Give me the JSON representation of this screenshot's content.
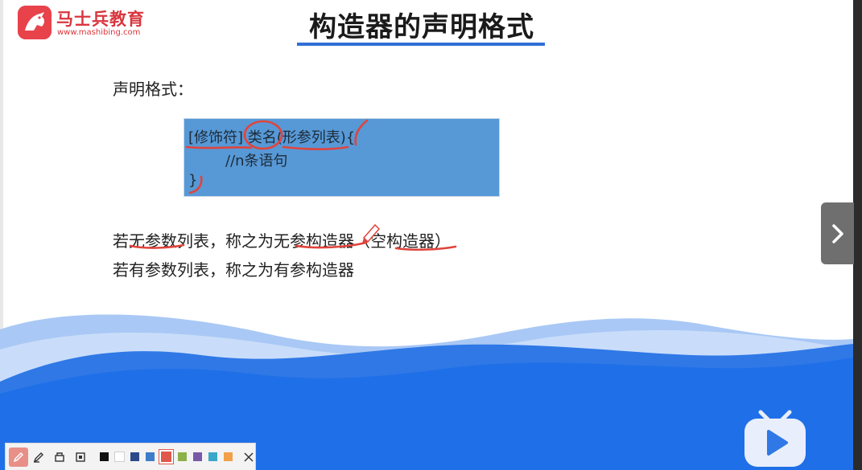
{
  "logo": {
    "name": "马士兵教育",
    "url": "www.mashibing.com"
  },
  "slide": {
    "title": "构造器的声明格式",
    "label": "声明格式：",
    "code": {
      "line1": "[修饰符] 类名(形参列表){",
      "line2": "//n条语句",
      "line3": "}"
    },
    "text1": "若无参数列表，称之为无参构造器（空构造器）",
    "text2": "若有参数列表，称之为有参构造器"
  },
  "toolbar": {
    "tools": [
      "pen-icon",
      "highlighter-icon",
      "eraser-icon",
      "clear-board-icon"
    ],
    "colors": [
      "#111111",
      "#ffffff",
      "#2c4a8a",
      "#3e7dc9",
      "#e0574c",
      "#8cb04a",
      "#7a58a8",
      "#3aa7c8",
      "#f3a04a"
    ],
    "selected_color": "#e0574c"
  },
  "nav": {
    "next_icon": "chevron-right-icon"
  },
  "player": {
    "icon": "bilibili-tv-play-icon"
  }
}
